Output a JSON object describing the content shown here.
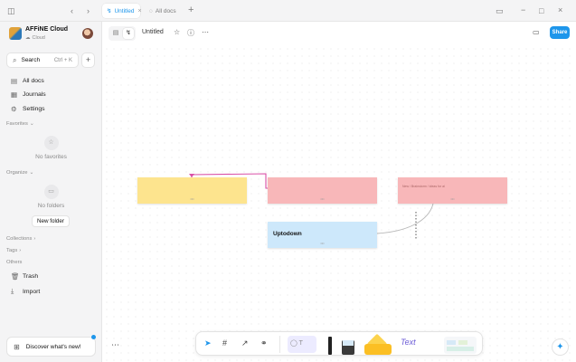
{
  "tabs": [
    {
      "label": "Untitled",
      "active": true
    },
    {
      "label": "All docs",
      "active": false
    }
  ],
  "workspace": {
    "name": "AFFiNE Cloud",
    "sub": "Cloud"
  },
  "search": {
    "label": "Search",
    "shortcut": "Ctrl + K"
  },
  "nav": {
    "all_docs": "All docs",
    "journals": "Journals",
    "settings": "Settings"
  },
  "sections": {
    "favorites": "Favorites",
    "organize": "Organize",
    "collections": "Collections",
    "tags": "Tags",
    "others": "Others"
  },
  "empty": {
    "favorites": "No favorites",
    "folders": "No folders"
  },
  "new_folder": "New folder",
  "others": {
    "trash": "Trash",
    "import": "Import"
  },
  "discover": "Discover what's new!",
  "doc": {
    "title": "Untitled",
    "share": "Share"
  },
  "notes": {
    "pink_right_text": "New / Brainstorm / ideas for ai",
    "blue_title": "Uptodown"
  },
  "colors": {
    "accent": "#1e96eb",
    "note_yellow": "#fde48e",
    "note_pink": "#f8b7b9",
    "note_blue": "#cde8fb",
    "connector": "#d94fa6"
  }
}
